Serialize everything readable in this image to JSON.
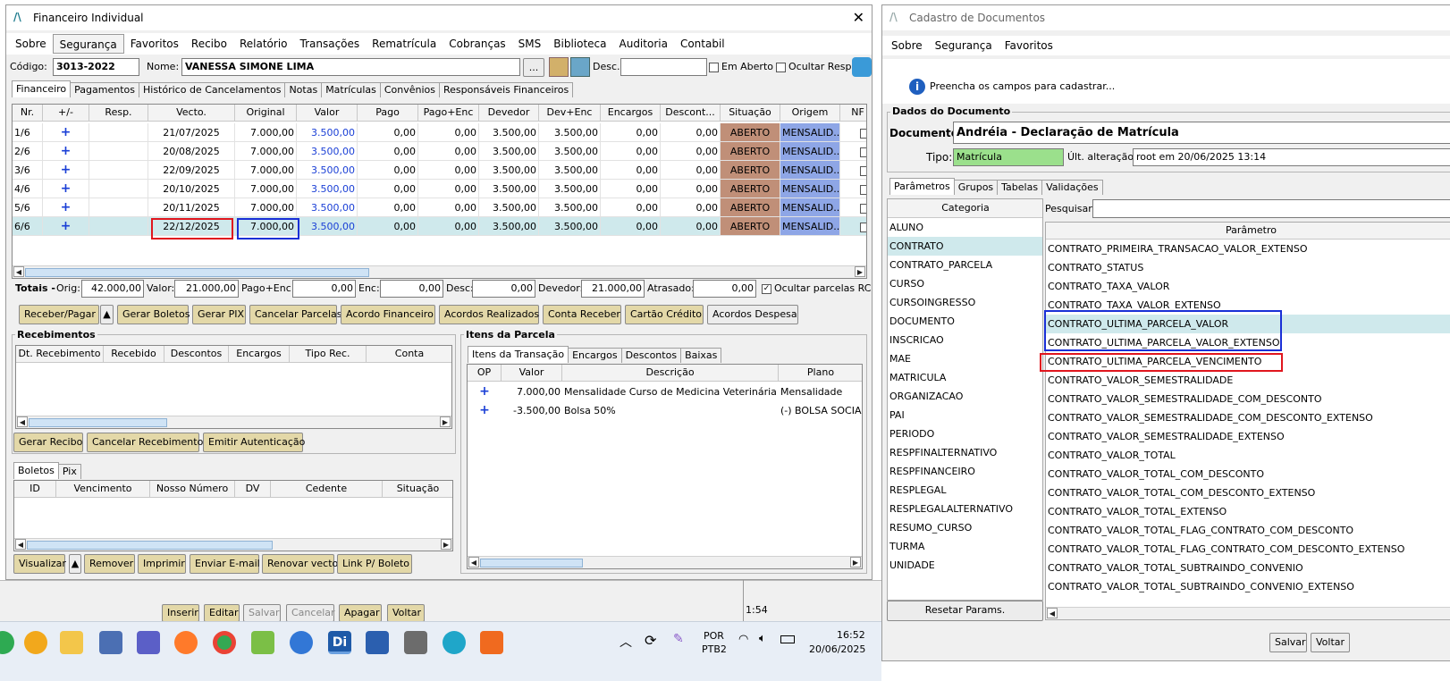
{
  "left_window": {
    "title": "Financeiro Individual",
    "menu": [
      "Sobre",
      "Segurança",
      "Favoritos",
      "Recibo",
      "Relatório",
      "Transações",
      "Rematrícula",
      "Cobranças",
      "SMS",
      "Biblioteca",
      "Auditoria",
      "Contabil"
    ],
    "codigo_label": "Código:",
    "codigo_value": "3013-2022",
    "nome_label": "Nome:",
    "nome_value": "VANESSA SIMONE LIMA",
    "ellipsis_label": "...",
    "desc_label": "Desc.:",
    "em_aberto_label": "Em Aberto",
    "ocultar_resp_label": "Ocultar Resp.",
    "tabs": [
      "Financeiro",
      "Pagamentos",
      "Histórico de Cancelamentos",
      "Notas",
      "Matrículas",
      "Convênios",
      "Responsáveis Financeiros"
    ],
    "grid_headers": [
      "Nr.",
      "+/-",
      "Resp.",
      "Vecto.",
      "Original",
      "Valor",
      "Pago",
      "Pago+Enc",
      "Devedor",
      "Dev+Enc",
      "Encargos",
      "Descont...",
      "Situação",
      "Origem",
      "NF"
    ],
    "rows": [
      {
        "nr": "1/6",
        "vecto": "21/07/2025",
        "original": "7.000,00",
        "valor": "3.500,00",
        "pago": "0,00",
        "pagoenc": "0,00",
        "devedor": "3.500,00",
        "devenc": "3.500,00",
        "encargos": "0,00",
        "desc": "0,00",
        "situacao": "ABERTO",
        "origem": "MENSALID..."
      },
      {
        "nr": "2/6",
        "vecto": "20/08/2025",
        "original": "7.000,00",
        "valor": "3.500,00",
        "pago": "0,00",
        "pagoenc": "0,00",
        "devedor": "3.500,00",
        "devenc": "3.500,00",
        "encargos": "0,00",
        "desc": "0,00",
        "situacao": "ABERTO",
        "origem": "MENSALID..."
      },
      {
        "nr": "3/6",
        "vecto": "22/09/2025",
        "original": "7.000,00",
        "valor": "3.500,00",
        "pago": "0,00",
        "pagoenc": "0,00",
        "devedor": "3.500,00",
        "devenc": "3.500,00",
        "encargos": "0,00",
        "desc": "0,00",
        "situacao": "ABERTO",
        "origem": "MENSALID..."
      },
      {
        "nr": "4/6",
        "vecto": "20/10/2025",
        "original": "7.000,00",
        "valor": "3.500,00",
        "pago": "0,00",
        "pagoenc": "0,00",
        "devedor": "3.500,00",
        "devenc": "3.500,00",
        "encargos": "0,00",
        "desc": "0,00",
        "situacao": "ABERTO",
        "origem": "MENSALID..."
      },
      {
        "nr": "5/6",
        "vecto": "20/11/2025",
        "original": "7.000,00",
        "valor": "3.500,00",
        "pago": "0,00",
        "pagoenc": "0,00",
        "devedor": "3.500,00",
        "devenc": "3.500,00",
        "encargos": "0,00",
        "desc": "0,00",
        "situacao": "ABERTO",
        "origem": "MENSALID..."
      },
      {
        "nr": "6/6",
        "vecto": "22/12/2025",
        "original": "7.000,00",
        "valor": "3.500,00",
        "pago": "0,00",
        "pagoenc": "0,00",
        "devedor": "3.500,00",
        "devenc": "3.500,00",
        "encargos": "0,00",
        "desc": "0,00",
        "situacao": "ABERTO",
        "origem": "MENSALID..."
      }
    ],
    "plus_glyph": "+",
    "totais": {
      "title": "Totais -",
      "orig_label": "Orig:",
      "orig": "42.000,00",
      "valor_label": "Valor:",
      "valor": "21.000,00",
      "pagoenc_label": "Pago+Enc:",
      "pagoenc": "0,00",
      "enc_label": "Enc:",
      "enc": "0,00",
      "desc_label": "Desc:",
      "desc": "0,00",
      "devedor_label": "Devedor:",
      "devedor": "21.000,00",
      "atrasado_label": "Atrasado:",
      "atrasado": "0,00",
      "ocultar_label": "Ocultar parcelas RC"
    },
    "action_buttons": [
      "Receber/Pagar",
      "Gerar Boletos",
      "Gerar PIX",
      "Cancelar Parcelas",
      "Acordo Financeiro",
      "Acordos Realizados",
      "Conta Receber",
      "Cartão Crédito",
      "Acordos Despesa"
    ],
    "recebimentos": {
      "title": "Recebimentos",
      "headers": [
        "Dt. Recebimento",
        "Recebido",
        "Descontos",
        "Encargos",
        "Tipo Rec.",
        "Conta"
      ],
      "buttons": [
        "Gerar Recibo",
        "Cancelar Recebimento",
        "Emitir Autenticação"
      ]
    },
    "boletos": {
      "tabs": [
        "Boletos",
        "Pix"
      ],
      "headers": [
        "ID",
        "Vencimento",
        "Nosso Número",
        "DV",
        "Cedente",
        "Situação"
      ],
      "buttons": [
        "Visualizar",
        "Remover",
        "Imprimir",
        "Enviar E-mail",
        "Renovar vecto",
        "Link P/ Boleto"
      ]
    },
    "itens": {
      "title": "Itens da Parcela",
      "tabs": [
        "Itens da Transação",
        "Encargos",
        "Descontos",
        "Baixas"
      ],
      "headers": [
        "OP",
        "Valor",
        "Descrição",
        "Plano"
      ],
      "rows": [
        {
          "valor": "7.000,00",
          "descricao": "Mensalidade Curso de Medicina Veterinária",
          "plano": "Mensalidade"
        },
        {
          "valor": "-3.500,00",
          "descricao": "Bolsa 50%",
          "plano": "(-) BOLSA SOCIAL"
        }
      ]
    }
  },
  "back_toolbar": {
    "buttons": [
      "Inserir",
      "Editar",
      "Salvar",
      "Cancelar",
      "Apagar",
      "Voltar"
    ],
    "time_fragment": "1:54"
  },
  "right_window": {
    "title": "Cadastro de Documentos",
    "menu": [
      "Sobre",
      "Segurança",
      "Favoritos"
    ],
    "info": "Preencha os campos para cadastrar...",
    "group_title": "Dados do Documento",
    "documento_label": "Documento:",
    "documento_value": "Andréia - Declaração de Matrícula",
    "tipo_label": "Tipo:",
    "tipo_value": "Matrícula",
    "ult_label": "Últ. alteração:",
    "ult_value": "root em 20/06/2025 13:14",
    "tabs": [
      "Parâmetros",
      "Grupos",
      "Tabelas",
      "Validações"
    ],
    "categoria_header": "Categoria",
    "categorias": [
      "ALUNO",
      "CONTRATO",
      "CONTRATO_PARCELA",
      "CURSO",
      "CURSOINGRESSO",
      "DOCUMENTO",
      "INSCRICAO",
      "MAE",
      "MATRICULA",
      "ORGANIZACAO",
      "PAI",
      "PERIODO",
      "RESPFINALTERNATIVO",
      "RESPFINANCEIRO",
      "RESPLEGAL",
      "RESPLEGALALTERNATIVO",
      "RESUMO_CURSO",
      "TURMA",
      "UNIDADE"
    ],
    "pesquisar_label": "Pesquisar:",
    "parametro_header": "Parâmetro",
    "parametros": [
      "CONTRATO_PRIMEIRA_TRANSACAO_VALOR_EXTENSO",
      "CONTRATO_STATUS",
      "CONTRATO_TAXA_VALOR",
      "CONTRATO_TAXA_VALOR_EXTENSO",
      "CONTRATO_ULTIMA_PARCELA_VALOR",
      "CONTRATO_ULTIMA_PARCELA_VALOR_EXTENSO",
      "CONTRATO_ULTIMA_PARCELA_VENCIMENTO",
      "CONTRATO_VALOR_SEMESTRALIDADE",
      "CONTRATO_VALOR_SEMESTRALIDADE_COM_DESCONTO",
      "CONTRATO_VALOR_SEMESTRALIDADE_COM_DESCONTO_EXTENSO",
      "CONTRATO_VALOR_SEMESTRALIDADE_EXTENSO",
      "CONTRATO_VALOR_TOTAL",
      "CONTRATO_VALOR_TOTAL_COM_DESCONTO",
      "CONTRATO_VALOR_TOTAL_COM_DESCONTO_EXTENSO",
      "CONTRATO_VALOR_TOTAL_EXTENSO",
      "CONTRATO_VALOR_TOTAL_FLAG_CONTRATO_COM_DESCONTO",
      "CONTRATO_VALOR_TOTAL_FLAG_CONTRATO_COM_DESCONTO_EXTENSO",
      "CONTRATO_VALOR_TOTAL_SUBTRAINDO_CONVENIO",
      "CONTRATO_VALOR_TOTAL_SUBTRAINDO_CONVENIO_EXTENSO"
    ],
    "reset_label": "Resetar Params.",
    "salvar_label": "Salvar",
    "voltar_label": "Voltar"
  },
  "taskbar": {
    "lang1": "POR",
    "lang2": "PTB2",
    "time": "16:52",
    "date": "20/06/2025",
    "di_label": "Di"
  },
  "colors": {
    "highlight_red": "#e0161e",
    "highlight_blue": "#1a2fd6",
    "situacao": "#c08f78",
    "origem": "#8ea6e6",
    "tipo_bg": "#9be08c"
  }
}
